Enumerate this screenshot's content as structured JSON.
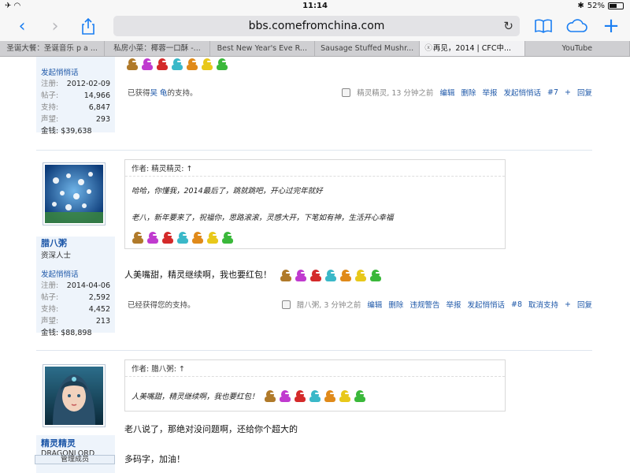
{
  "status": {
    "time": "11:14",
    "battery": "52%"
  },
  "browser": {
    "url": "bbs.comefromchina.com"
  },
  "tabs": [
    "圣诞大餐：圣诞音乐 p a ...",
    "私房小菜：椰蓉一口酥 -...",
    "Best New Year's Eve R...",
    "Sausage Stuffed Mushr...",
    "再见，2014 | CFC中...",
    "YouTube"
  ],
  "post1": {
    "send_msg": "发起悄悄话",
    "stats": [
      {
        "k": "注册:",
        "v": "2012-02-09"
      },
      {
        "k": "帖子:",
        "v": "14,966"
      },
      {
        "k": "支持:",
        "v": "6,847"
      },
      {
        "k": "声望:",
        "v": "293"
      }
    ],
    "money": "金钱: $39,638",
    "support_text": "已获得",
    "support_user": "吴 龟",
    "support_text2": "的支持。",
    "footer_user": "精灵精灵, 13 分钟之前",
    "actions": [
      "编辑",
      "删除",
      "举报",
      "发起悄悄话",
      "#7",
      "+",
      "回复"
    ]
  },
  "post2": {
    "username": "腊八粥",
    "title": "资深人士",
    "send_msg": "发起悄悄话",
    "stats": [
      {
        "k": "注册:",
        "v": "2014-04-06"
      },
      {
        "k": "帖子:",
        "v": "2,592"
      },
      {
        "k": "支持:",
        "v": "4,452"
      },
      {
        "k": "声望:",
        "v": "213"
      }
    ],
    "money": "金钱: $88,898",
    "quote_header": "作者: 精灵精灵: ↑",
    "quote_line1": "哈哈，你懂我，2014最后了，跳就跳吧，开心过完年就好",
    "quote_line2": "老八，新年要来了，祝福你，思路滚滚，灵感大开，下笔如有神，生活开心幸福",
    "message": "人美嘴甜，精灵继续啊，我也要红包！",
    "support_text": "已经获得您的支持。",
    "footer_user": "腊八粥, 3 分钟之前",
    "actions": [
      "编辑",
      "删除",
      "违规警告",
      "举报",
      "发起悄悄话",
      "#8",
      "取消支持",
      "+",
      "回复"
    ]
  },
  "post3": {
    "username": "精灵精灵",
    "title": "DRAGONLORD",
    "badge": "管理成员",
    "quote_header": "作者: 腊八粥: ↑",
    "quote_line1": "人美嘴甜，精灵继续啊，我也要红包！",
    "message1": "老八说了，那绝对没问题啊，还给你个超大的",
    "message2": "多码字，加油！"
  },
  "emoticon_colors": [
    "#b07a2a",
    "#c03acf",
    "#d42a2a",
    "#3ab8c8",
    "#e08a1a",
    "#e8c81a",
    "#3ab83a"
  ]
}
